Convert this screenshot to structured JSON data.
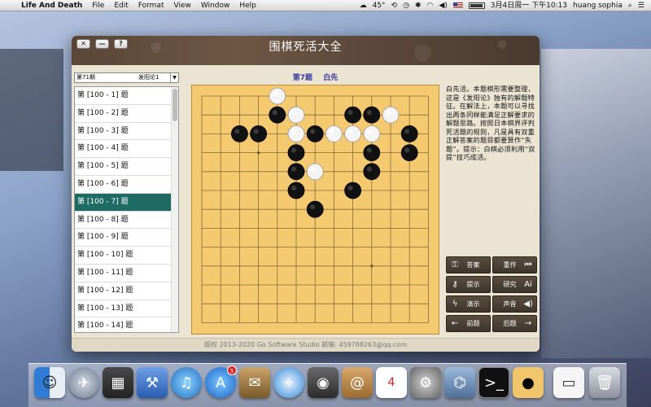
{
  "menubar": {
    "app_name": "Life And Death",
    "menus": [
      "File",
      "Edit",
      "Format",
      "View",
      "Window",
      "Help"
    ],
    "temperature": "45°",
    "datetime": "3月4日周一 下午10:13",
    "user": "huang sophia"
  },
  "window": {
    "title": "围棋死活大全",
    "buttons": {
      "close": "✕",
      "minimize": "—",
      "help": "?"
    }
  },
  "volume_select": {
    "volume": "第71期",
    "book": "发阳论1",
    "arrow": "▼"
  },
  "problem_list": {
    "items": [
      "第 [100 - 1] 题",
      "第 [100 - 2] 题",
      "第 [100 - 3] 题",
      "第 [100 - 4] 题",
      "第 [100 - 5] 题",
      "第 [100 - 6] 题",
      "第 [100 - 7] 题",
      "第 [100 - 8] 题",
      "第 [100 - 9] 题",
      "第 [100 - 10] 题",
      "第 [100 - 11] 题",
      "第 [100 - 12] 题",
      "第 [100 - 13] 题",
      "第 [100 - 14] 题"
    ],
    "selected_index": 6
  },
  "problem_header": {
    "number": "第7题",
    "to_play": "白先"
  },
  "board": {
    "size": 13,
    "star_points": [
      [
        3,
        3
      ],
      [
        9,
        9
      ]
    ],
    "stones": [
      {
        "color": "white",
        "col": 4,
        "row": 0
      },
      {
        "color": "black",
        "col": 4,
        "row": 1
      },
      {
        "color": "white",
        "col": 5,
        "row": 1
      },
      {
        "color": "black",
        "col": 8,
        "row": 1
      },
      {
        "color": "black",
        "col": 9,
        "row": 1
      },
      {
        "color": "white",
        "col": 10,
        "row": 1
      },
      {
        "color": "black",
        "col": 2,
        "row": 2
      },
      {
        "color": "black",
        "col": 3,
        "row": 2
      },
      {
        "color": "white",
        "col": 5,
        "row": 2
      },
      {
        "color": "black",
        "col": 6,
        "row": 2
      },
      {
        "color": "white",
        "col": 7,
        "row": 2
      },
      {
        "color": "white",
        "col": 8,
        "row": 2
      },
      {
        "color": "white",
        "col": 9,
        "row": 2
      },
      {
        "color": "black",
        "col": 11,
        "row": 2
      },
      {
        "color": "black",
        "col": 5,
        "row": 3
      },
      {
        "color": "black",
        "col": 9,
        "row": 3
      },
      {
        "color": "black",
        "col": 11,
        "row": 3
      },
      {
        "color": "black",
        "col": 5,
        "row": 4
      },
      {
        "color": "white",
        "col": 6,
        "row": 4
      },
      {
        "color": "black",
        "col": 9,
        "row": 4
      },
      {
        "color": "black",
        "col": 5,
        "row": 5
      },
      {
        "color": "black",
        "col": 8,
        "row": 5
      },
      {
        "color": "black",
        "col": 6,
        "row": 6
      }
    ]
  },
  "hint": "白先活。本题棋形需要整理，这是《发阳论》独有的解题特征。在解法上，本题可以寻找出两条同样能满足正解要求的解题思路。按照日本棋界评判死活题的规则，凡是具有双重正解答案的题目都要算作“失题”。提示：白棋必须利用“双提”技巧成活。",
  "controls": {
    "answer": "答案",
    "redo": "重作",
    "hint": "提示",
    "research": "研究",
    "demo": "演示",
    "sound": "声音",
    "prev": "前题",
    "next": "后题"
  },
  "footer": "版权 2013-2020 Go Software Studio 邮箱: 459788263@qq.com",
  "dock": {
    "app_store_badge": "5",
    "calendar_day": "4"
  }
}
